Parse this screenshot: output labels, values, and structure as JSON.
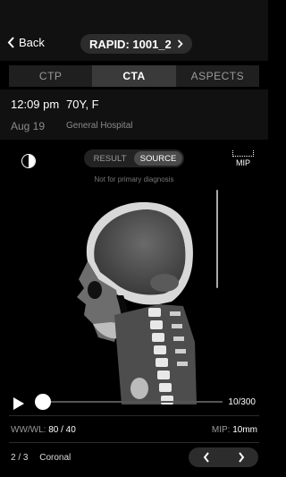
{
  "nav": {
    "back_label": "Back",
    "study_label": "RAPID: 1001_2"
  },
  "tabs": [
    {
      "label": "CTP"
    },
    {
      "label": "CTA"
    },
    {
      "label": "ASPECTS"
    }
  ],
  "active_tab": "CTA",
  "patient": {
    "time": "12:09 pm",
    "demographics": "70Y, F",
    "date": "Aug 19",
    "hospital": "General Hospital"
  },
  "viewer": {
    "toggle": [
      "RESULT",
      "SOURCE"
    ],
    "toggle_selected": "SOURCE",
    "mip_label": "MIP",
    "disclaimer": "Not for primary diagnosis",
    "frame_counter": "10/300",
    "progress": 0.033,
    "wwwl_label": "WW/WL:",
    "wwwl_value": "80 / 40",
    "mip_thickness_label": "MIP:",
    "mip_thickness_value": "10mm",
    "series_index": "2 / 3",
    "series_plane": "Coronal"
  },
  "icons": [
    "chevron-left-icon",
    "chevron-right-icon",
    "contrast-icon",
    "mip-icon",
    "play-icon",
    "prev-icon",
    "next-icon"
  ]
}
